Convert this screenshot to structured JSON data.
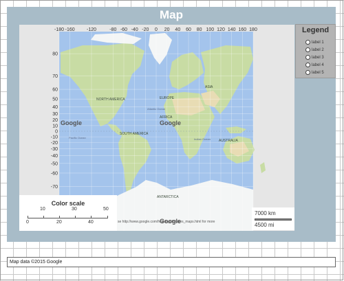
{
  "title": "Map",
  "legend": {
    "title": "Legend",
    "items": [
      "label 1",
      "label 2",
      "label 3",
      "label 4",
      "label 5"
    ]
  },
  "color_scale": {
    "title": "Color scale",
    "top_ticks": [
      "10",
      "30",
      "50"
    ],
    "bottom_ticks": [
      "0",
      "20",
      "40"
    ]
  },
  "scale": {
    "km": "7000 km",
    "mi": "4500 mi"
  },
  "attribution": "se http://www.google.com/help/legalnotices_maps.html for more",
  "footer": "Map data ©2015 Google",
  "google_marks": [
    "Google",
    "Google",
    "Google"
  ],
  "map_labels": {
    "continents": [
      "NORTH AMERICA",
      "SOUTH AMERICA",
      "EUROPE",
      "AFRICA",
      "ASIA",
      "AUSTRALIA",
      "ANTARCTICA"
    ],
    "oceans": [
      "Atlantic Ocean",
      "Pacific Ocean",
      "Indian Ocean"
    ]
  },
  "colors": {
    "panel": "#a8bcc8",
    "ocean": "#a4c4ec",
    "land": "#c8dca4",
    "desert": "#e8dcb4",
    "ice": "#f4f6f6",
    "map_background": "#e6e6e6"
  },
  "chart_data": {
    "type": "map",
    "projection": "mercator",
    "x_ticks": [
      "-180",
      "-160",
      "-120",
      "-80",
      "-60",
      "-40",
      "-20",
      "0",
      "20",
      "40",
      "60",
      "80",
      "100",
      "120",
      "140",
      "160",
      "180"
    ],
    "y_ticks": [
      "80",
      "70",
      "60",
      "50",
      "40",
      "30",
      "20",
      "10",
      "0",
      "-10",
      "-20",
      "-30",
      "-40",
      "-50",
      "-60",
      "-70"
    ],
    "x_range": [
      -180,
      180
    ],
    "y_range": [
      -85,
      85
    ],
    "grid": true,
    "legend_position": "top-right"
  }
}
